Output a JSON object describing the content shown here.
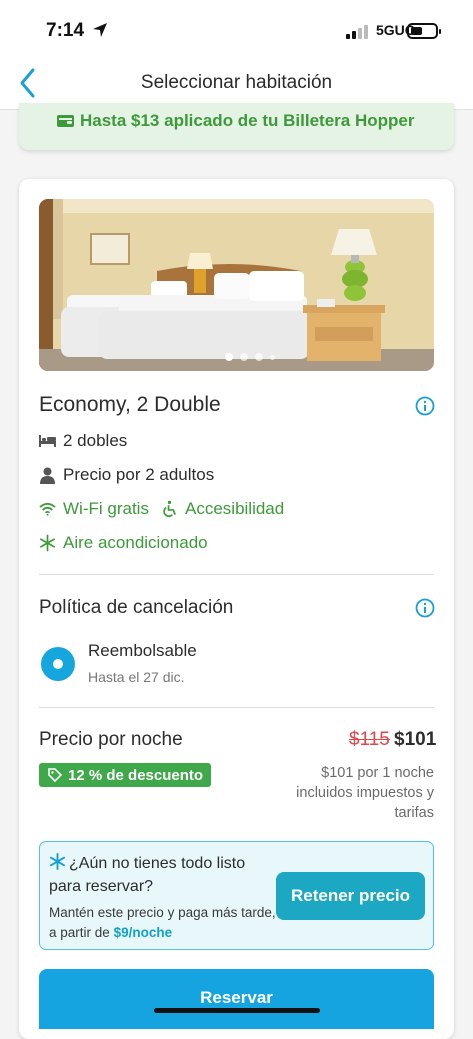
{
  "status_bar": {
    "time": "7:14",
    "network": "5GUC"
  },
  "nav": {
    "title": "Seleccionar habitación"
  },
  "wallet_banner": {
    "text": "Hasta $13 aplicado de tu Billetera Hopper"
  },
  "room": {
    "name": "Economy, 2 Double",
    "beds": "2 dobles",
    "occupancy": "Precio por 2 adultos",
    "amenities": [
      "Wi-Fi gratis",
      "Accesibilidad",
      "Aire acondicionado"
    ],
    "photo_count_dots": 4
  },
  "cancellation": {
    "title": "Política de cancelación",
    "option_label": "Reembolsable",
    "option_sub": "Hasta el 27 dic."
  },
  "price": {
    "label": "Precio por noche",
    "old": "$115",
    "new": "$101",
    "discount": "12 % de descuento",
    "note": "$101 por 1 noche incluidos impuestos y tarifas"
  },
  "hold": {
    "question": "¿Aún no tienes todo listo para reservar?",
    "sub_prefix": "Mantén este precio y paga más tarde, a partir de",
    "sub_price": "$9/noche",
    "button": "Retener precio"
  },
  "book_button": "Reservar",
  "colors": {
    "accent_blue": "#15a4e0",
    "green": "#3d9a3a",
    "old_price_red": "#e0474c",
    "teal": "#1ca8c2"
  }
}
